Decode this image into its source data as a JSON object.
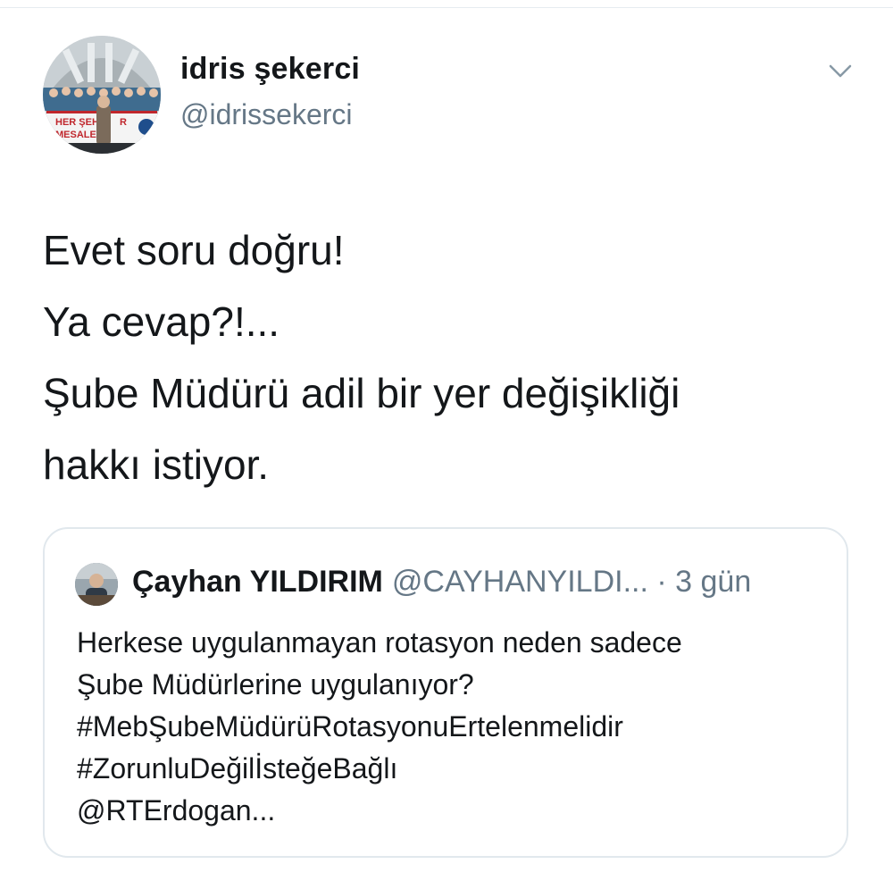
{
  "tweet": {
    "author_name": "idris şekerci",
    "author_handle": "@idrissekerci",
    "text_lines": [
      "Evet soru doğru!",
      "Ya cevap?!...",
      "Şube Müdürü adil bir yer değişikliği",
      "hakkı istiyor."
    ],
    "avatar_banner_lines": [
      "HER ŞEHİR",
      "MESALE"
    ],
    "avatar_banner_r": "R"
  },
  "quoted_tweet": {
    "author_name": "Çayhan YILDIRIM",
    "author_handle": "@CAYHANYILDI...",
    "time": " · 3 gün",
    "text_lines": [
      "Herkese uygulanmayan  rotasyon neden sadece",
      "Şube Müdürlerine uygulanıyor?",
      "#MebŞubeMüdürüRotasyonuErtelenmelidir",
      "#ZorunluDeğilİsteğeBağlı",
      "@RTErdogan..."
    ]
  },
  "icons": {
    "more": "chevron-down-icon"
  },
  "colors": {
    "text_primary": "#14171a",
    "text_secondary": "#657786",
    "border": "#e1e8ed",
    "chevron": "#8899a6"
  }
}
